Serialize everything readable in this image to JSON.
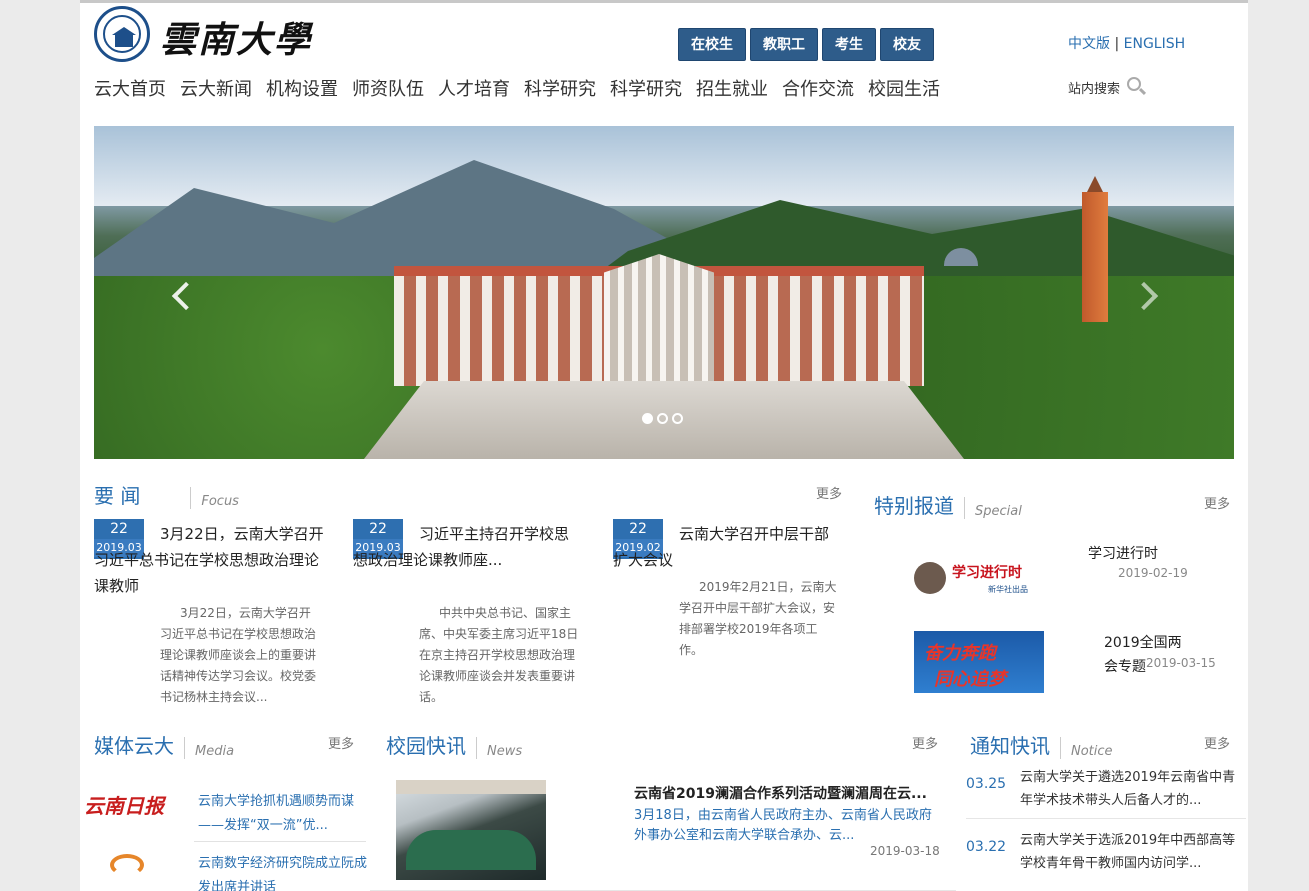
{
  "header": {
    "brand": "雲南大學",
    "roles": [
      "在校生",
      "教职工",
      "考生",
      "校友"
    ],
    "lang_cn": "中文版",
    "lang_sep": "|",
    "lang_en": "ENGLISH",
    "search_label": "站内搜索"
  },
  "nav": [
    "云大首页",
    "云大新闻",
    "机构设置",
    "师资队伍",
    "人才培育",
    "科学研究",
    "科学研究",
    "招生就业",
    "合作交流",
    "校园生活"
  ],
  "banner": {
    "slides": 3,
    "active_slide": 1
  },
  "focus": {
    "title_cn": "要 闻",
    "title_en": "Focus",
    "more": "更多",
    "items": [
      {
        "day": "22",
        "month": "2019.03",
        "title": "3月22日，云南大学召开习近平总书记在学校思想政治理论课教师",
        "summary": "3月22日，云南大学召开习近平总书记在学校思想政治理论课教师座谈会上的重要讲话精神传达学习会议。校党委书记杨林主持会议..."
      },
      {
        "day": "22",
        "month": "2019.03",
        "title": "习近平主持召开学校思想政治理论课教师座...",
        "summary": "中共中央总书记、国家主席、中央军委主席习近平18日在京主持召开学校思想政治理论课教师座谈会并发表重要讲话。"
      },
      {
        "day": "22",
        "month": "2019.02",
        "title": "云南大学召开中层干部扩大会议",
        "summary": "2019年2月21日，云南大学召开中层干部扩大会议，安排部署学校2019年各项工作。"
      }
    ]
  },
  "special": {
    "title_cn": "特别报道",
    "title_en": "Special",
    "more": "更多",
    "items": [
      {
        "thumb_main": "学习进行时",
        "thumb_sub": "新华社出品",
        "title": "学习进行时",
        "date": "2019-02-19"
      },
      {
        "thumb_line1": "奋力奔跑",
        "thumb_line2": "同心追梦",
        "title": "2019全国两会专题",
        "date": "2019-03-15"
      }
    ]
  },
  "media": {
    "title_cn": "媒体云大",
    "title_en": "Media",
    "more": "更多",
    "items": [
      {
        "logo": "云南日报",
        "title": "云南大学抢抓机遇顺势而谋——发挥“双一流”优..."
      },
      {
        "logo": "",
        "title": "云南数字经济研究院成立阮成发出席并讲话"
      }
    ]
  },
  "campus": {
    "title_cn": "校园快讯",
    "title_en": "News",
    "more": "更多",
    "headline": "云南省2019澜湄合作系列活动暨澜湄周在云...",
    "summary": "3月18日，由云南省人民政府主办、云南省人民政府外事办公室和云南大学联合承办、云...",
    "date": "2019-03-18"
  },
  "notice": {
    "title_cn": "通知快讯",
    "title_en": "Notice",
    "more": "更多",
    "items": [
      {
        "date": "03.25",
        "title": "云南大学关于遴选2019年云南省中青年学术技术带头人后备人才的..."
      },
      {
        "date": "03.22",
        "title": "云南大学关于选派2019年中西部高等学校青年骨干教师国内访问学..."
      }
    ]
  },
  "colors": {
    "accent": "#2a6fb0",
    "role_button": "#2e5c8a",
    "date_badge": "#2e6fb0"
  }
}
